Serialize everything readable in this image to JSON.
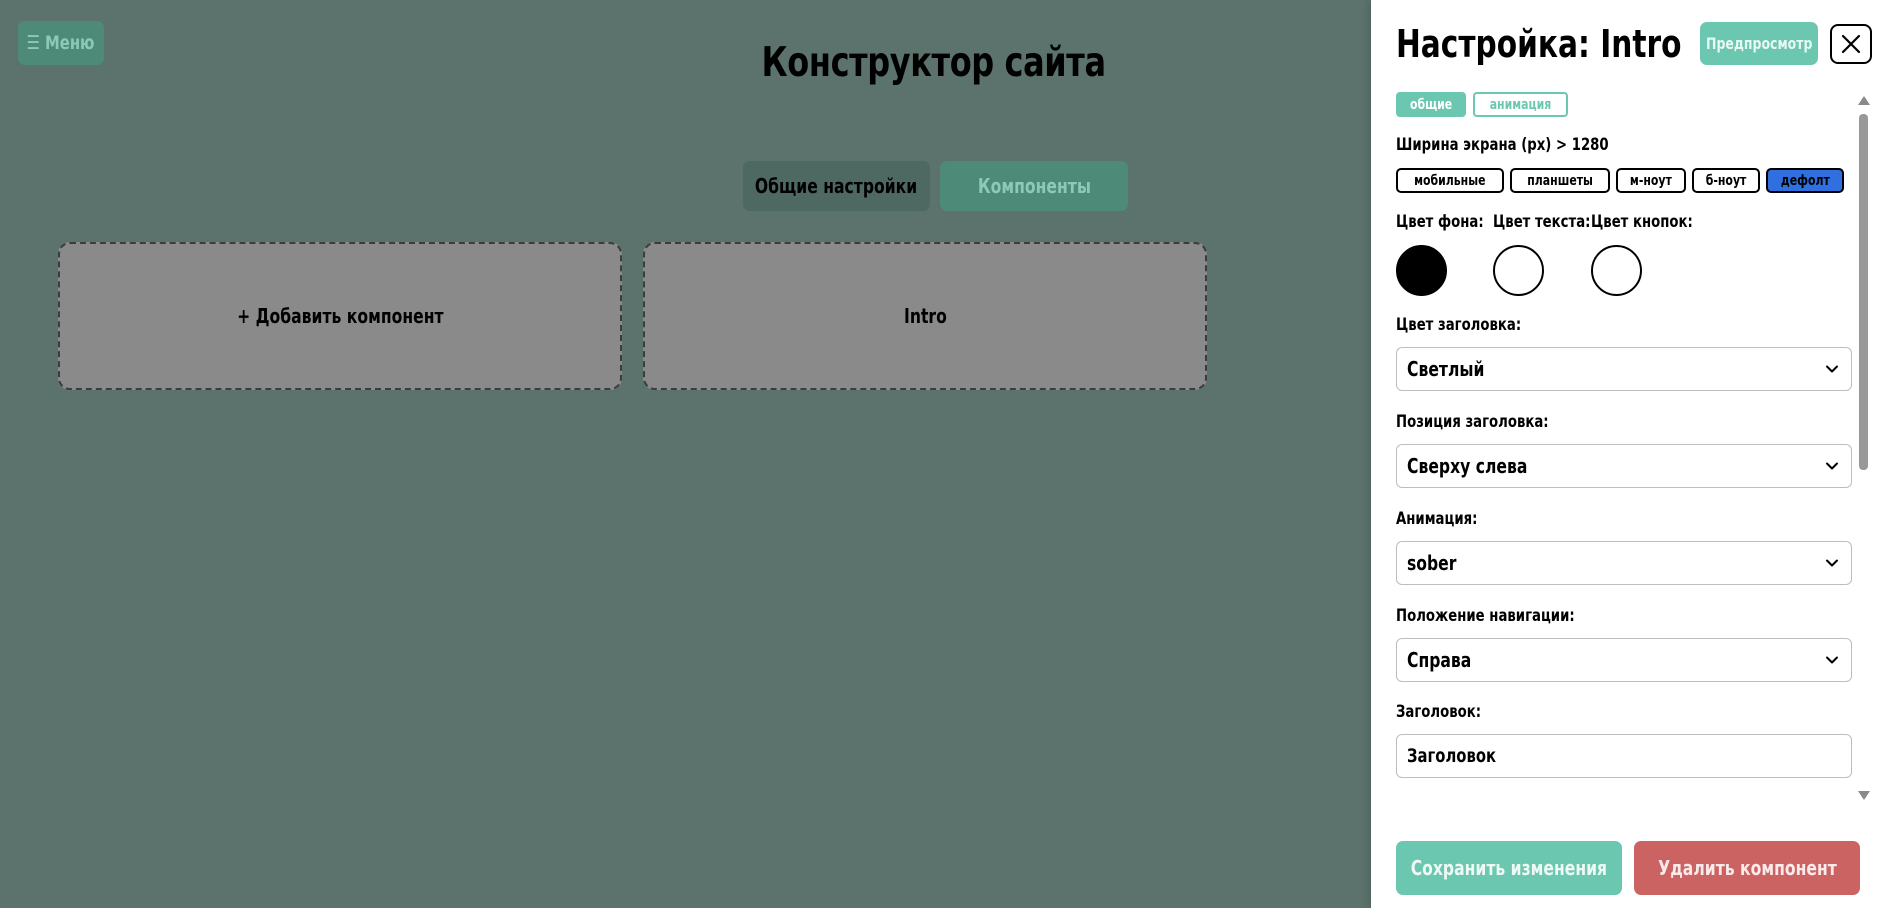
{
  "menu": {
    "label": "☰ Меню"
  },
  "app": {
    "title": "Конструктор сайта"
  },
  "tabs": [
    {
      "label": "Общие настройки"
    },
    {
      "label": "Компоненты"
    }
  ],
  "cards": [
    {
      "label": "+ Добавить компонент"
    },
    {
      "label": "Intro"
    }
  ],
  "panel": {
    "title": "Настройка: Intro",
    "preview_label": "Предпросмотр",
    "section_tabs": [
      {
        "label": "общие",
        "active": true
      },
      {
        "label": "анимация",
        "active": false
      }
    ],
    "screen_width_label": "Ширина экрана (px) > 1280",
    "breakpoints": [
      {
        "label": "мобильные",
        "active": false
      },
      {
        "label": "планшеты",
        "active": false
      },
      {
        "label": "м-ноут",
        "active": false
      },
      {
        "label": "б-ноут",
        "active": false
      },
      {
        "label": "дефолт",
        "active": true
      }
    ],
    "colors": [
      {
        "label": "Цвет фона:",
        "value": "#000000"
      },
      {
        "label": "Цвет текста:",
        "value": "#ffffff"
      },
      {
        "label": "Цвет кнопок:",
        "value": "#ffffff"
      }
    ],
    "fields": {
      "heading_color": {
        "label": "Цвет заголовка:",
        "value": "Светлый"
      },
      "heading_position": {
        "label": "Позиция заголовка:",
        "value": "Сверху слева"
      },
      "animation": {
        "label": "Анимация:",
        "value": "sober"
      },
      "nav_position": {
        "label": "Положение навигации:",
        "value": "Справа"
      },
      "heading": {
        "label": "Заголовок:",
        "value": "Заголовок"
      }
    },
    "save_label": "Сохранить изменения",
    "delete_label": "Удалить компонент"
  },
  "colors": {
    "background": "#5b736c",
    "accent": "#6bc7b0",
    "danger": "#cc6363",
    "active_breakpoint": "#2f6fe0"
  }
}
